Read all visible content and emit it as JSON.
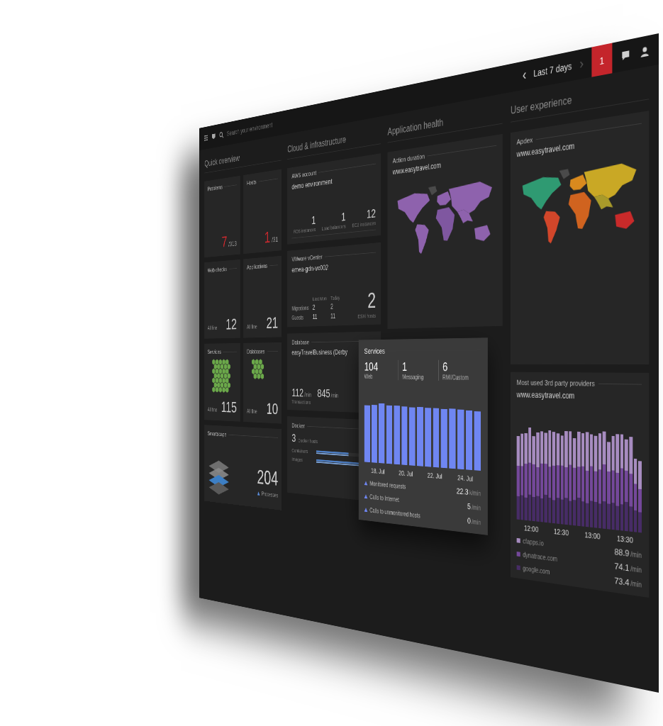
{
  "topbar": {
    "search_placeholder": "Search your environment",
    "prev": "‹",
    "timeframe": "Last 7 days",
    "next": "›",
    "problems_badge": "1"
  },
  "quick_overview": {
    "title": "Quick overview",
    "tiles": [
      {
        "kind": "ratio",
        "title": "Problems",
        "value": "7",
        "total": "/313"
      },
      {
        "kind": "ratio",
        "title": "Hosts",
        "value": "1",
        "total": "/31"
      },
      {
        "kind": "count",
        "title": "Web checks",
        "status": "All fine",
        "value": "12"
      },
      {
        "kind": "count",
        "title": "Applications",
        "status": "All fine",
        "value": "21"
      },
      {
        "kind": "hex",
        "title": "Services",
        "status": "All fine",
        "value": "115"
      },
      {
        "kind": "hex",
        "title": "Databases",
        "status": "All fine",
        "value": "10"
      },
      {
        "kind": "smartscape",
        "title": "Smartscape",
        "value": "204",
        "label": "Processes"
      }
    ]
  },
  "cloud": {
    "title": "Cloud & infrastructure",
    "aws": {
      "title": "AWS account",
      "name": "demo environment",
      "stats": [
        {
          "value": "1",
          "label": "RDS instances"
        },
        {
          "value": "1",
          "label": "Load balancers"
        },
        {
          "value": "12",
          "label": "EC2 instances"
        }
      ]
    },
    "vmware": {
      "title": "VMware vCenter",
      "name": "emea-gdn-vc002",
      "columns": [
        "Last Mon",
        "Today"
      ],
      "rows": [
        {
          "label": "Migrations",
          "values": [
            "2",
            "2"
          ]
        },
        {
          "label": "Guests",
          "values": [
            "11",
            "11"
          ]
        }
      ],
      "hosts_value": "2",
      "hosts_label": "ESXi hosts"
    },
    "database": {
      "title": "Database",
      "name": "easyTravelBusiness (Derby",
      "stats": [
        {
          "value": "112",
          "unit": "/min",
          "label": "Transactions"
        },
        {
          "value": "845",
          "unit": "/min",
          "label": ""
        }
      ]
    },
    "docker": {
      "title": "Docker",
      "hosts_value": "3",
      "hosts_label": "Docker hosts",
      "rows": [
        {
          "label": "Containers",
          "level": 0.55
        },
        {
          "label": "Images",
          "level": 0.8
        }
      ]
    }
  },
  "app_health": {
    "title": "Application health",
    "card_title": "Action duration",
    "app": "www.easytravel.com",
    "regions": [
      {
        "color": "#8e62ad"
      },
      {
        "color": "#4a4a4a"
      },
      {
        "color": "#8e62ad"
      },
      {
        "color": "#8e62ad"
      },
      {
        "color": "#7f57a0"
      },
      {
        "color": "#8e62ad"
      },
      {
        "color": "#8e62ad"
      },
      {
        "color": "#8e62ad"
      }
    ]
  },
  "services": {
    "title": "Services",
    "counts": [
      {
        "value": "104",
        "label": "Web"
      },
      {
        "value": "1",
        "label": "Messaging"
      },
      {
        "value": "6",
        "label": "RMI/Custom"
      }
    ],
    "values": [
      21.6,
      21.9,
      22.4,
      21.9,
      21.7,
      21.5,
      21.4,
      21.6,
      21.3,
      21.4,
      21.2,
      21.3,
      21.1,
      21.0,
      20.6
    ],
    "ticks": [
      "18. Jul",
      "20. Jul",
      "22. Jul",
      "24. Jul"
    ],
    "legend": [
      {
        "label": "Monitored requests",
        "value": "22.3",
        "unit": "k/min"
      },
      {
        "label": "Calls to Internet",
        "value": "5",
        "unit": "/min"
      },
      {
        "label": "Calls to unmonitored hosts",
        "value": "0",
        "unit": "/min"
      }
    ]
  },
  "user_experience": {
    "title": "User experience",
    "card_title": "Apdex",
    "app": "www.easytravel.com",
    "regions": [
      {
        "color": "#2f9a72"
      },
      {
        "color": "#4a4a4a"
      },
      {
        "color": "#d2462a"
      },
      {
        "color": "#d98a1e"
      },
      {
        "color": "#d0631f"
      },
      {
        "color": "#c9a825"
      },
      {
        "color": "#a89a2a"
      },
      {
        "color": "#c92a2a"
      }
    ]
  },
  "third_party": {
    "title": "Most used 3rd party providers",
    "app": "www.easytravel.com",
    "ticks": [
      "12:00",
      "12:30",
      "13:00",
      "13:30"
    ],
    "series": [
      {
        "name": "cfapps.io",
        "value": "88.9",
        "unit": "/min",
        "color": "#a78cc0",
        "values": [
          38,
          42,
          40,
          45,
          36,
          44,
          41,
          39,
          47,
          43,
          40,
          38,
          46,
          42,
          37,
          44,
          41,
          48,
          39,
          43,
          45,
          40,
          36,
          42,
          47,
          41,
          38,
          44,
          30,
          34
        ]
      },
      {
        "name": "dynatrace.com",
        "value": "74.1",
        "unit": "/min",
        "color": "#74489a",
        "values": [
          40,
          38,
          44,
          41,
          42,
          37,
          45,
          40,
          39,
          44,
          41,
          43,
          38,
          46,
          40,
          39,
          44,
          41,
          43,
          38,
          42,
          45,
          40,
          39,
          41,
          44,
          38,
          40,
          32,
          28
        ]
      },
      {
        "name": "google.com",
        "value": "73.4",
        "unit": "/min",
        "color": "#472c66",
        "values": [
          30,
          32,
          29,
          34,
          31,
          33,
          30,
          35,
          32,
          29,
          33,
          31,
          34,
          30,
          32,
          35,
          31,
          29,
          33,
          32,
          30,
          34,
          31,
          33,
          29,
          32,
          35,
          30,
          26,
          24
        ]
      }
    ]
  }
}
